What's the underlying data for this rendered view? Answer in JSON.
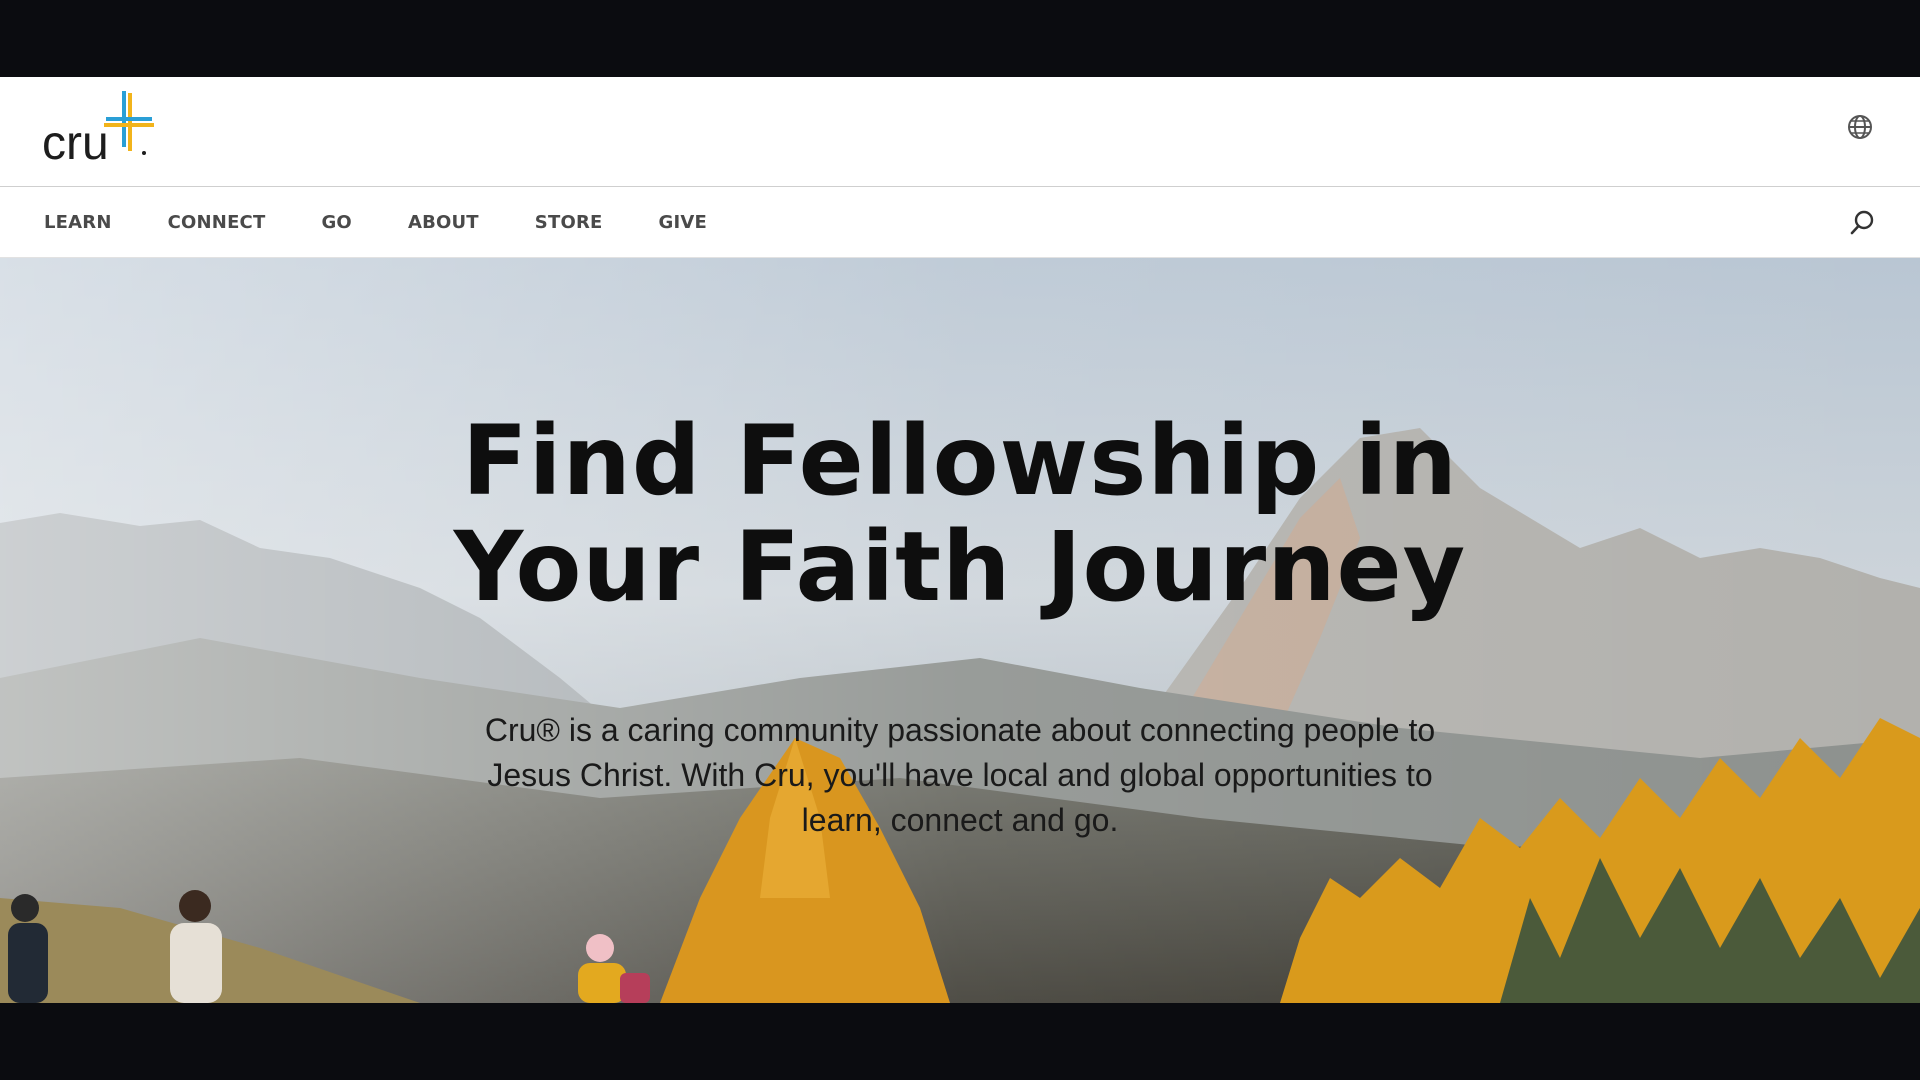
{
  "header": {
    "logo_text": "cru",
    "logo_mark": "+",
    "globe_icon": "globe-icon"
  },
  "nav": {
    "items": [
      {
        "label": "LEARN"
      },
      {
        "label": "CONNECT"
      },
      {
        "label": "GO"
      },
      {
        "label": "ABOUT"
      },
      {
        "label": "STORE"
      },
      {
        "label": "GIVE"
      }
    ],
    "search_icon": "search-icon"
  },
  "hero": {
    "title_line1": "Find Fellowship in",
    "title_line2": "Your Faith Journey",
    "text_line1": "Cru® is a caring community passionate about connecting people to",
    "text_line2": "Jesus Christ. With Cru, you'll have local and global opportunities to",
    "text_line3": "learn, connect and go."
  },
  "colors": {
    "page_background": "#0b0c10",
    "header_background": "#ffffff",
    "nav_text": "#4a4a4a",
    "hero_text": "#0e0e0e",
    "logo_cross_blue": "#2a9fd6",
    "logo_cross_yellow": "#f2b41b"
  }
}
